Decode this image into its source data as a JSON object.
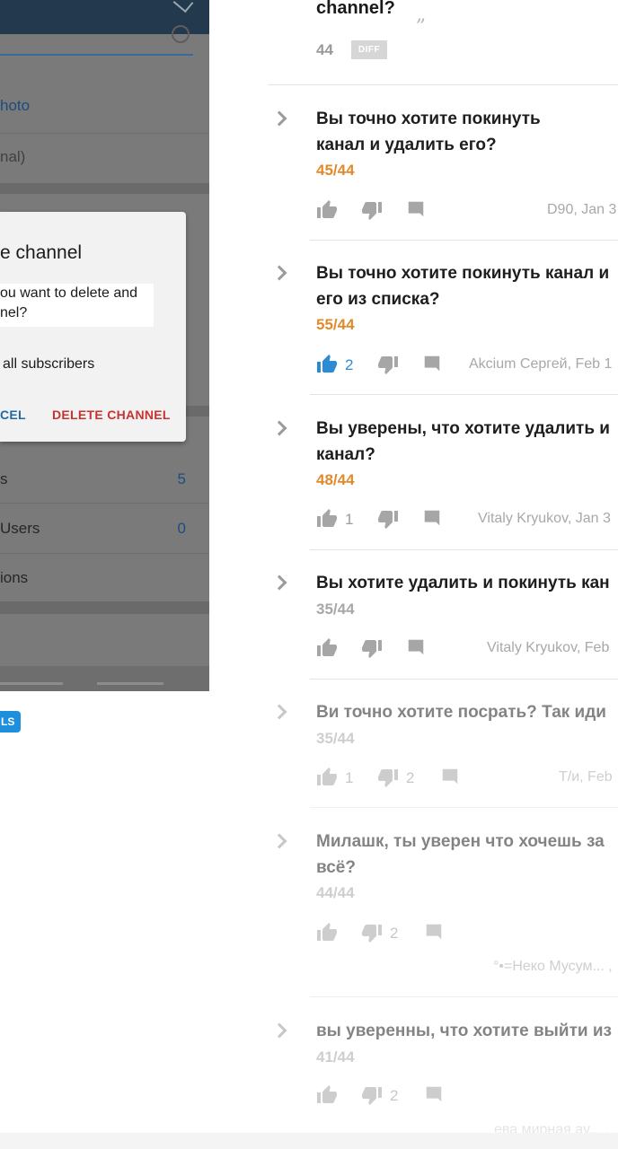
{
  "phone": {
    "menu_photo": "hoto",
    "menu_optional": "nal)",
    "dialog_title": "e channel",
    "dialog_message": "ou want to delete and\nnel?",
    "dialog_option": "all subscribers",
    "dialog_cancel": "CEL",
    "dialog_delete": "DELETE CHANNEL",
    "row_subscribers_label": "s",
    "row_subscribers_count": "5",
    "row_users_label": "Users",
    "row_users_count": "0",
    "row_actions_label": "ions",
    "badge": "LS"
  },
  "header": {
    "title_fragment": "channel?",
    "quote_glyph": "„",
    "votes": "44",
    "diff_label": "DIFF"
  },
  "items": [
    {
      "title_line1": "Вы точно хотите покинуть",
      "title_line2": "канал и удалить его?",
      "score": "45/44",
      "up_count": "",
      "down_count": "",
      "author": "D90, Jan 3"
    },
    {
      "title_line1": "Вы точно хотите покинуть канал и",
      "title_line2": "его из списка?",
      "score": "55/44",
      "up_count": "2",
      "down_count": "",
      "author": "Akcium Сергей, Feb 1"
    },
    {
      "title_line1": "Вы уверены, что хотите удалить и",
      "title_line2": "канал?",
      "score": "48/44",
      "up_count": "1",
      "down_count": "",
      "author": "Vitaly Kryukov, Jan 3"
    },
    {
      "title_line1": "Вы хотите удалить и покинуть кан",
      "title_line2": "",
      "score": "35/44",
      "up_count": "",
      "down_count": "",
      "author": "Vitaly Kryukov, Feb"
    },
    {
      "title_line1": "Ви точно хотите посрать? Так иди",
      "title_line2": "",
      "score": "35/44",
      "up_count": "1",
      "down_count": "2",
      "author": "Т/и, Feb"
    },
    {
      "title_line1": "Милашк, ты уверен что хочешь за",
      "title_line2": "всё?",
      "score": "44/44",
      "up_count": "",
      "down_count": "2",
      "author": "°•=Неко Мусум... ,"
    },
    {
      "title_line1": "вы уверенны, что хотите выйти из",
      "title_line2": "",
      "score": "41/44",
      "up_count": "",
      "down_count": "2",
      "author": "ева мирная ау... ,"
    }
  ],
  "colors": {
    "score_accent": "#e08a2c",
    "liked_blue": "#2b8bd3",
    "delete_red": "#c8322f"
  }
}
